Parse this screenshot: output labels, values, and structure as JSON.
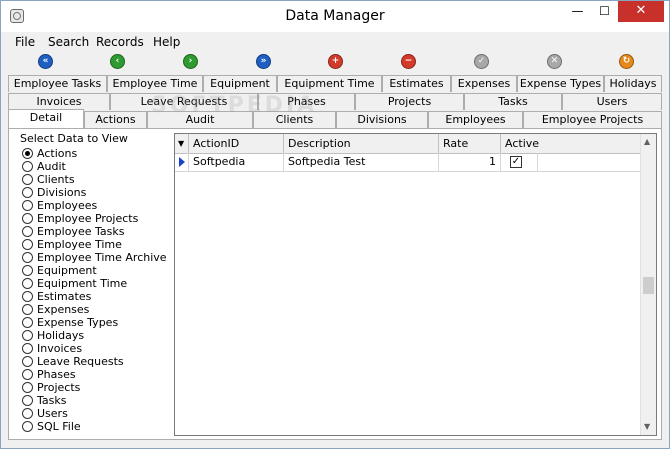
{
  "window": {
    "title": "Data Manager",
    "minimize": "—",
    "maximize": "☐",
    "close": "✕"
  },
  "menu": [
    "File",
    "Search",
    "Records",
    "Help"
  ],
  "toolbar": {
    "buttons": [
      {
        "name": "first-record-button",
        "icon": "first-icon",
        "glyph": "«",
        "color": "#1f5fc4"
      },
      {
        "name": "previous-record-button",
        "icon": "previous-icon",
        "glyph": "‹",
        "color": "#2f9a2f"
      },
      {
        "name": "next-record-button",
        "icon": "next-icon",
        "glyph": "›",
        "color": "#2f9a2f"
      },
      {
        "name": "last-record-button",
        "icon": "last-icon",
        "glyph": "»",
        "color": "#1f5fc4"
      },
      {
        "name": "add-record-button",
        "icon": "add-icon",
        "glyph": "+",
        "color": "#d23a2a"
      },
      {
        "name": "delete-record-button",
        "icon": "delete-icon",
        "glyph": "−",
        "color": "#d23a2a"
      },
      {
        "name": "save-record-button",
        "icon": "save-icon",
        "glyph": "✓",
        "color": "#a8a8a8"
      },
      {
        "name": "cancel-record-button",
        "icon": "cancel-icon",
        "glyph": "✕",
        "color": "#a8a8a8"
      },
      {
        "name": "refresh-button",
        "icon": "refresh-icon",
        "glyph": "↻",
        "color": "#e58a1a"
      }
    ]
  },
  "tabs": {
    "row1": [
      "Employee Tasks",
      "Employee Time",
      "Equipment",
      "Equipment Time",
      "Estimates",
      "Expenses",
      "Expense Types",
      "Holidays"
    ],
    "row2": [
      "Invoices",
      "Leave Requests",
      "Phases",
      "Projects",
      "Tasks",
      "Users"
    ],
    "row3": [
      "Detail",
      "Actions",
      "Audit",
      "Clients",
      "Divisions",
      "Employees",
      "Employee Projects"
    ],
    "active": "Detail"
  },
  "select_panel": {
    "label": "Select Data to View",
    "options": [
      "Actions",
      "Audit",
      "Clients",
      "Divisions",
      "Employees",
      "Employee Projects",
      "Employee Tasks",
      "Employee Time",
      "Employee Time Archive",
      "Equipment",
      "Equipment Time",
      "Estimates",
      "Expenses",
      "Expense Types",
      "Holidays",
      "Invoices",
      "Leave Requests",
      "Phases",
      "Projects",
      "Tasks",
      "Users",
      "SQL File"
    ],
    "selected": "Actions"
  },
  "grid": {
    "sort_indicator": "▼",
    "columns": [
      "ActionID",
      "Description",
      "Rate",
      "Active"
    ],
    "rows": [
      {
        "ActionID": "Softpedia",
        "Description": "Softpedia Test",
        "Rate": "1",
        "Active": true
      }
    ],
    "check_glyph": "✓"
  },
  "watermark": "SOFTPEDIA"
}
